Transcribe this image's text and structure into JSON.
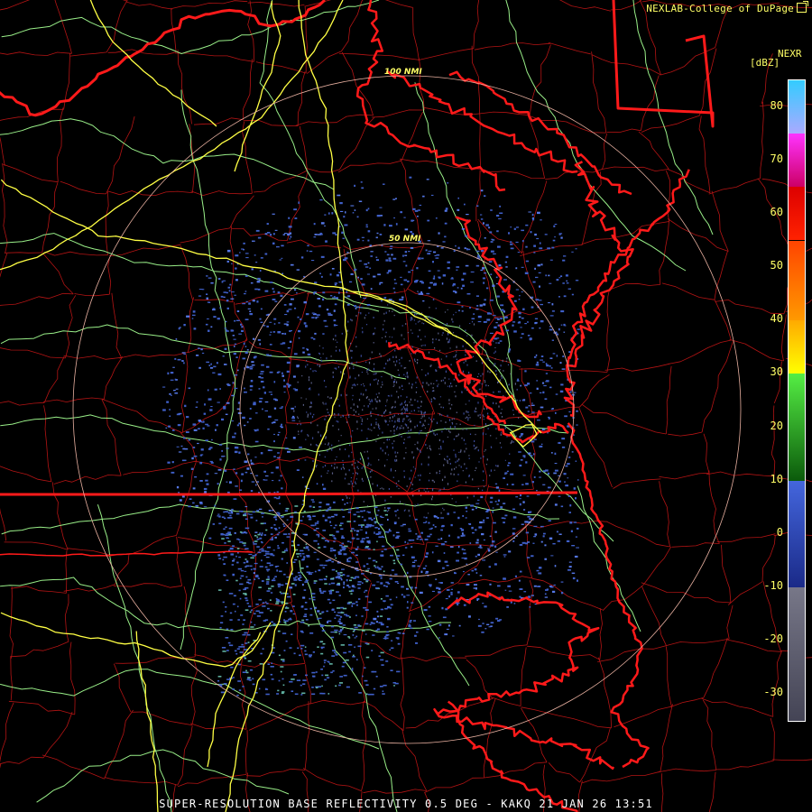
{
  "credit": "NEXLAB-College of DuPage",
  "credit_icon": "external-link-icon",
  "product_title": "SUPER-RESOLUTION BASE REFLECTIVITY 0.5 DEG - KAKQ 21 JAN 26 13:51",
  "legend": {
    "title": "NEXR",
    "unit": "[dBZ]",
    "ticks": [
      "80",
      "70",
      "60",
      "50",
      "40",
      "30",
      "20",
      "10",
      "0",
      "-10",
      "-20",
      "-30"
    ],
    "range": [
      -35,
      85
    ],
    "colors": [
      {
        "from": -35,
        "to": -10,
        "top": "#777788",
        "bottom": "#444455"
      },
      {
        "from": -10,
        "to": 10,
        "top": "#4466dd",
        "bottom": "#1a2a88"
      },
      {
        "from": 10,
        "to": 30,
        "top": "#55ee44",
        "bottom": "#0b5a0b"
      },
      {
        "from": 30,
        "to": 40,
        "top": "#ffaa00",
        "bottom": "#ffff00"
      },
      {
        "from": 40,
        "to": 55,
        "top": "#ff4400",
        "bottom": "#ff9900"
      },
      {
        "from": 55,
        "to": 65,
        "top": "#dd0000",
        "bottom": "#ff2200"
      },
      {
        "from": 65,
        "to": 75,
        "top": "#ff33ff",
        "bottom": "#cc0066"
      },
      {
        "from": 75,
        "to": 85,
        "top": "#33ccff",
        "bottom": "#aaaaff"
      }
    ]
  },
  "range_rings": [
    {
      "label": "50 NMI"
    },
    {
      "label": "100 NMI"
    }
  ],
  "colors": {
    "coast": "#ff1a1a",
    "county": "#b31414",
    "interstate": "#ffff44",
    "highway": "#99ee88",
    "ring": "#e8b0a0",
    "echo": "#3f5fc8"
  }
}
